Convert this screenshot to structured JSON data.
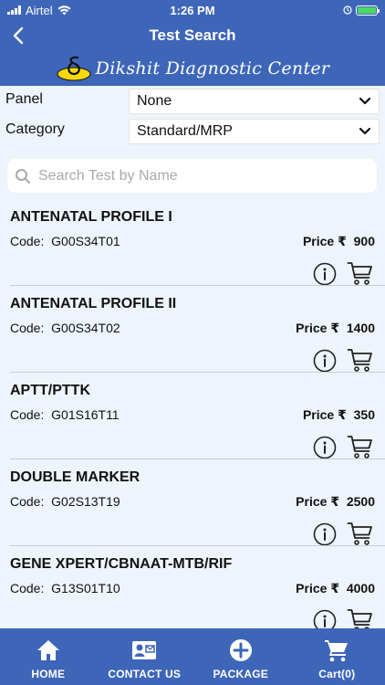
{
  "status": {
    "carrier": "Airtel",
    "time": "1:26 PM"
  },
  "header": {
    "title": "Test Search"
  },
  "brand": {
    "name": "Dikshit Diagnostic Center"
  },
  "filters": {
    "panel": {
      "label": "Panel",
      "value": "None"
    },
    "category": {
      "label": "Category",
      "value": "Standard/MRP"
    }
  },
  "search": {
    "placeholder": "Search Test by Name",
    "value": ""
  },
  "currency": "₹",
  "tests": [
    {
      "name": "ANTENATAL PROFILE I",
      "code_label": "Code:",
      "code": "G00S34T01",
      "price_label": "Price",
      "price": "900"
    },
    {
      "name": "ANTENATAL PROFILE II",
      "code_label": "Code:",
      "code": "G00S34T02",
      "price_label": "Price",
      "price": "1400"
    },
    {
      "name": "APTT/PTTK",
      "code_label": "Code:",
      "code": "G01S16T11",
      "price_label": "Price",
      "price": "350"
    },
    {
      "name": "DOUBLE MARKER",
      "code_label": "Code:",
      "code": "G02S13T19",
      "price_label": "Price",
      "price": "2500"
    },
    {
      "name": "GENE XPERT/CBNAAT-MTB/RIF",
      "code_label": "Code:",
      "code": "G13S01T10",
      "price_label": "Price",
      "price": "4000"
    }
  ],
  "tabs": [
    {
      "label": "HOME",
      "icon": "home-icon"
    },
    {
      "label": "CONTACT US",
      "icon": "contact-card-icon"
    },
    {
      "label": "PACKAGE",
      "icon": "add-circle-icon"
    },
    {
      "label": "Cart(0)",
      "icon": "cart-icon"
    }
  ],
  "colors": {
    "primary": "#3e66b8",
    "background": "#eef4fb",
    "battery": "#4cd964"
  }
}
